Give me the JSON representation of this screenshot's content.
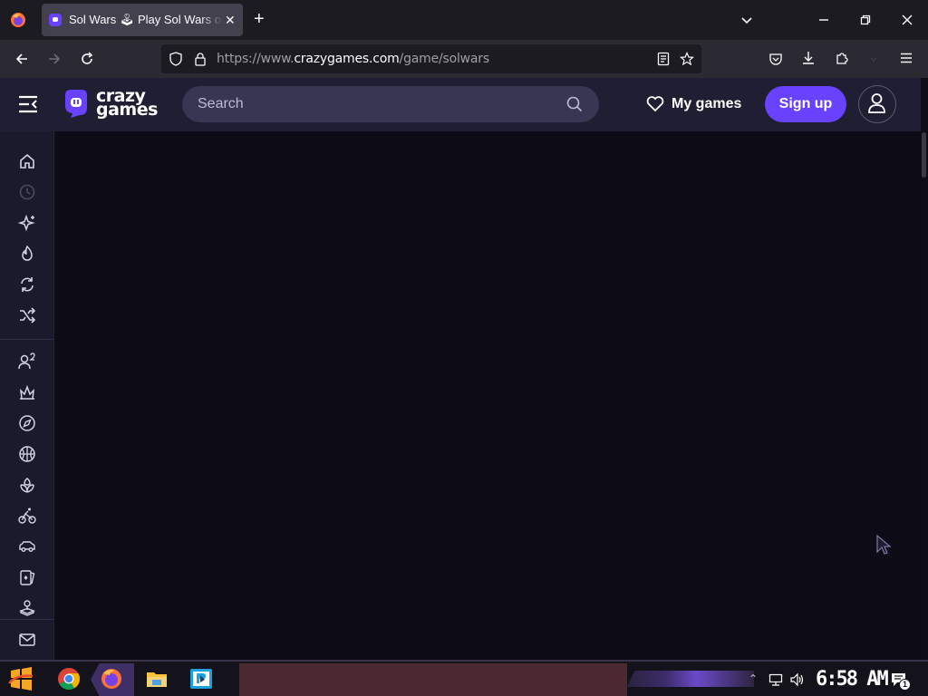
{
  "browser": {
    "tab_title": "Sol Wars 🕹 Play Sol Wars on CrazyGames",
    "url_domain": "https://www.crazygames.com",
    "url_path": "/game/solwars"
  },
  "header": {
    "logo_line1": "crazy",
    "logo_line2": "games",
    "search_placeholder": "Search",
    "my_games_label": "My games",
    "signup_label": "Sign up"
  },
  "sidebar": {
    "items": [
      "home-icon",
      "clock-icon",
      "sparkle-icon",
      "fire-icon",
      "refresh-icon",
      "shuffle-icon",
      "multiplayer-icon",
      "action-icon",
      "compass-icon",
      "basketball-icon",
      "flower-icon",
      "bike-icon",
      "car-icon",
      "cards-icon",
      "joystick-icon"
    ],
    "bottom": "mail-icon"
  },
  "taskbar": {
    "time": "6:58 AM",
    "notification_count": "1"
  },
  "colors": {
    "accent": "#6842ff",
    "header_bg": "#1f1e33",
    "page_bg": "#0c0b16"
  }
}
